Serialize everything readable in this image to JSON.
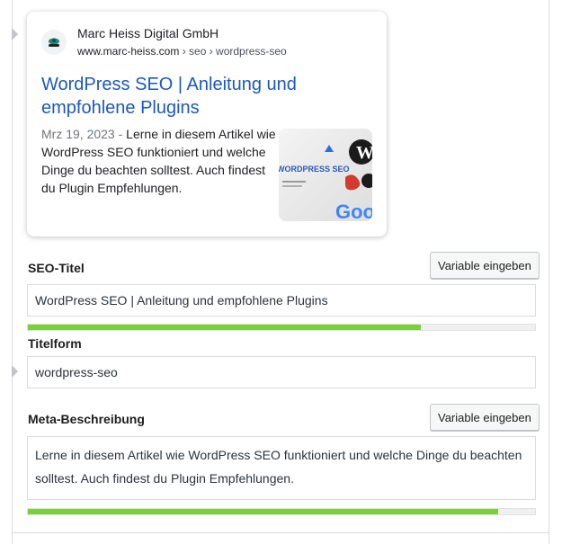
{
  "serp": {
    "site_name": "Marc Heiss Digital GmbH",
    "url_domain": "www.marc-heiss.com",
    "url_path": " › seo › wordpress-seo",
    "title": "WordPress SEO | Anleitung und empfohlene Plugins",
    "date": "Mrz 19, 2023",
    "separator": " - ",
    "snippet": "Lerne in diesem Artikel wie WordPress SEO funktioniert und welche Dinge du beachten solltest. Auch findest du Plugin Empfehlungen.",
    "thumbnail_text": "WORDPRESS SEO",
    "thumbnail_logo_text": "Goo"
  },
  "seo_title": {
    "label": "SEO-Titel",
    "button": "Variable eingeben",
    "value": "WordPress SEO | Anleitung und empfohlene Plugins",
    "progress": 0.774
  },
  "slug": {
    "label": "Titelform",
    "value": "wordpress-seo"
  },
  "meta_description": {
    "label": "Meta-Beschreibung",
    "button": "Variable eingeben",
    "value": "Lerne in diesem Artikel wie WordPress SEO funktioniert und welche Dinge du beachten solltest. Auch findest du Plugin Empfehlungen.",
    "progress": 0.928
  },
  "colors": {
    "link": "#1a57c6",
    "progress_good": "#7ad03a"
  }
}
